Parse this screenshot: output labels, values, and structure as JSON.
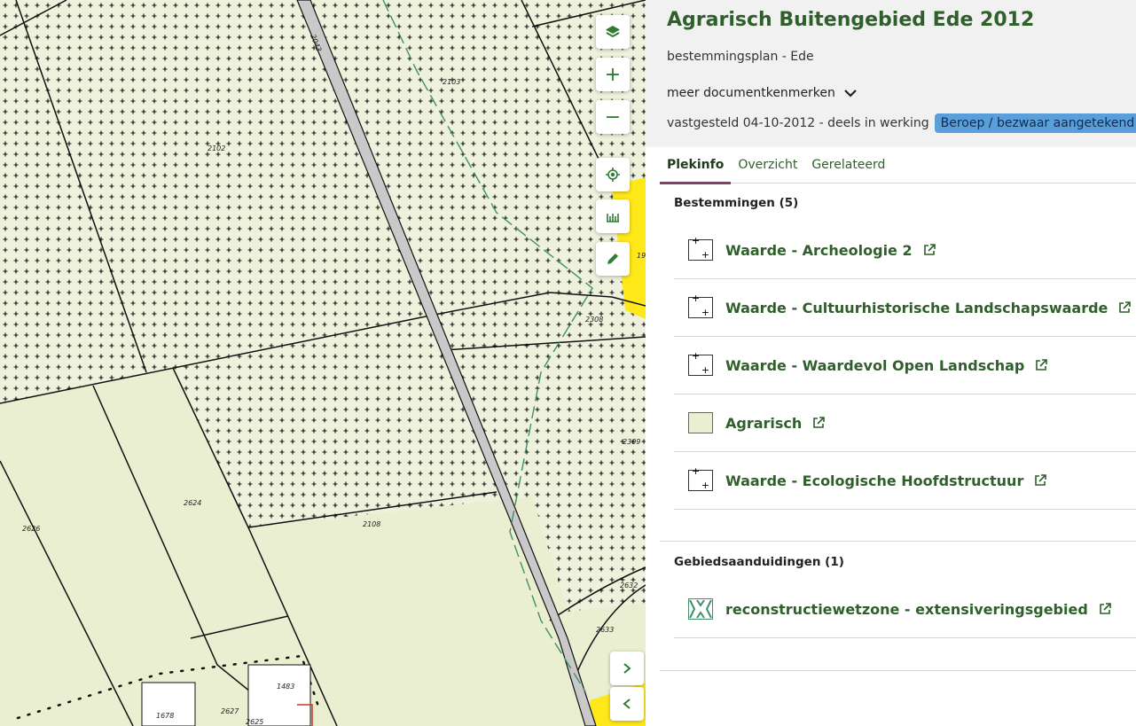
{
  "map": {
    "parcel_labels": [
      "2102",
      "2103",
      "2308",
      "2309",
      "2624",
      "2626",
      "2108",
      "2632",
      "2633",
      "1483",
      "1678",
      "2627",
      "2625",
      "2043",
      "19"
    ],
    "controls": {
      "layers": "layers-icon",
      "zoom_in": "+",
      "zoom_out": "−",
      "locate": "locate-icon",
      "measure": "ruler-icon",
      "draw": "pencil-icon",
      "next": "chevron-right-icon",
      "prev": "chevron-left-icon"
    }
  },
  "plan": {
    "title": "Agrarisch Buitengebied Ede 2012",
    "subtitle": "bestemmingsplan - Ede",
    "more": "meer documentkenmerken",
    "status": "vastgesteld 04-10-2012 - deels in werking",
    "badge": "Beroep / bezwaar aangetekend"
  },
  "tabs": [
    {
      "label": "Plekinfo",
      "active": true
    },
    {
      "label": "Overzicht",
      "active": false
    },
    {
      "label": "Gerelateerd",
      "active": false
    }
  ],
  "bestemmingen": {
    "title": "Bestemmingen (5)",
    "items": [
      {
        "label": "Waarde - Archeologie 2",
        "legend": "pattern"
      },
      {
        "label": "Waarde - Cultuurhistorische Landschapswaarde",
        "legend": "pattern"
      },
      {
        "label": "Waarde - Waardevol Open Landschap",
        "legend": "pattern"
      },
      {
        "label": "Agrarisch",
        "legend": "agrarisch"
      },
      {
        "label": "Waarde - Ecologische Hoofdstructuur",
        "legend": "pattern"
      }
    ]
  },
  "gebiedsaanduidingen": {
    "title": "Gebiedsaanduidingen (1)",
    "items": [
      {
        "label": "reconstructiewetzone - extensiveringsgebied",
        "legend": "reconstructie"
      }
    ]
  },
  "colors": {
    "brand_green": "#2f5f2b",
    "badge_blue": "#5a9fd9",
    "tab_underline": "#8a3d6d",
    "map_agrarisch": "#e9efd0",
    "map_yellow": "#ffe81a"
  }
}
